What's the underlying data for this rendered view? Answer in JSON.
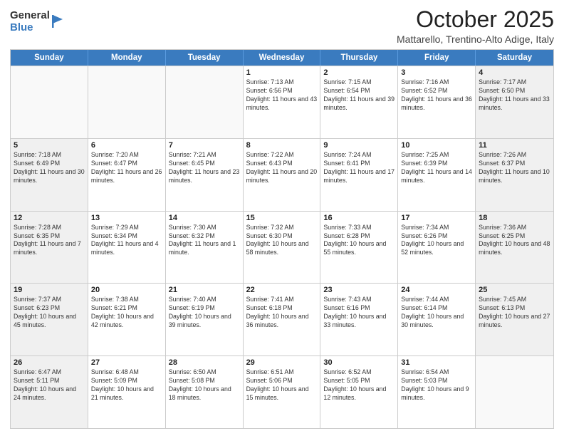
{
  "header": {
    "logo_general": "General",
    "logo_blue": "Blue",
    "title": "October 2025",
    "location": "Mattarello, Trentino-Alto Adige, Italy"
  },
  "days_of_week": [
    "Sunday",
    "Monday",
    "Tuesday",
    "Wednesday",
    "Thursday",
    "Friday",
    "Saturday"
  ],
  "weeks": [
    [
      {
        "day": "",
        "content": ""
      },
      {
        "day": "",
        "content": ""
      },
      {
        "day": "",
        "content": ""
      },
      {
        "day": "1",
        "content": "Sunrise: 7:13 AM\nSunset: 6:56 PM\nDaylight: 11 hours and 43 minutes."
      },
      {
        "day": "2",
        "content": "Sunrise: 7:15 AM\nSunset: 6:54 PM\nDaylight: 11 hours and 39 minutes."
      },
      {
        "day": "3",
        "content": "Sunrise: 7:16 AM\nSunset: 6:52 PM\nDaylight: 11 hours and 36 minutes."
      },
      {
        "day": "4",
        "content": "Sunrise: 7:17 AM\nSunset: 6:50 PM\nDaylight: 11 hours and 33 minutes."
      }
    ],
    [
      {
        "day": "5",
        "content": "Sunrise: 7:18 AM\nSunset: 6:49 PM\nDaylight: 11 hours and 30 minutes."
      },
      {
        "day": "6",
        "content": "Sunrise: 7:20 AM\nSunset: 6:47 PM\nDaylight: 11 hours and 26 minutes."
      },
      {
        "day": "7",
        "content": "Sunrise: 7:21 AM\nSunset: 6:45 PM\nDaylight: 11 hours and 23 minutes."
      },
      {
        "day": "8",
        "content": "Sunrise: 7:22 AM\nSunset: 6:43 PM\nDaylight: 11 hours and 20 minutes."
      },
      {
        "day": "9",
        "content": "Sunrise: 7:24 AM\nSunset: 6:41 PM\nDaylight: 11 hours and 17 minutes."
      },
      {
        "day": "10",
        "content": "Sunrise: 7:25 AM\nSunset: 6:39 PM\nDaylight: 11 hours and 14 minutes."
      },
      {
        "day": "11",
        "content": "Sunrise: 7:26 AM\nSunset: 6:37 PM\nDaylight: 11 hours and 10 minutes."
      }
    ],
    [
      {
        "day": "12",
        "content": "Sunrise: 7:28 AM\nSunset: 6:35 PM\nDaylight: 11 hours and 7 minutes."
      },
      {
        "day": "13",
        "content": "Sunrise: 7:29 AM\nSunset: 6:34 PM\nDaylight: 11 hours and 4 minutes."
      },
      {
        "day": "14",
        "content": "Sunrise: 7:30 AM\nSunset: 6:32 PM\nDaylight: 11 hours and 1 minute."
      },
      {
        "day": "15",
        "content": "Sunrise: 7:32 AM\nSunset: 6:30 PM\nDaylight: 10 hours and 58 minutes."
      },
      {
        "day": "16",
        "content": "Sunrise: 7:33 AM\nSunset: 6:28 PM\nDaylight: 10 hours and 55 minutes."
      },
      {
        "day": "17",
        "content": "Sunrise: 7:34 AM\nSunset: 6:26 PM\nDaylight: 10 hours and 52 minutes."
      },
      {
        "day": "18",
        "content": "Sunrise: 7:36 AM\nSunset: 6:25 PM\nDaylight: 10 hours and 48 minutes."
      }
    ],
    [
      {
        "day": "19",
        "content": "Sunrise: 7:37 AM\nSunset: 6:23 PM\nDaylight: 10 hours and 45 minutes."
      },
      {
        "day": "20",
        "content": "Sunrise: 7:38 AM\nSunset: 6:21 PM\nDaylight: 10 hours and 42 minutes."
      },
      {
        "day": "21",
        "content": "Sunrise: 7:40 AM\nSunset: 6:19 PM\nDaylight: 10 hours and 39 minutes."
      },
      {
        "day": "22",
        "content": "Sunrise: 7:41 AM\nSunset: 6:18 PM\nDaylight: 10 hours and 36 minutes."
      },
      {
        "day": "23",
        "content": "Sunrise: 7:43 AM\nSunset: 6:16 PM\nDaylight: 10 hours and 33 minutes."
      },
      {
        "day": "24",
        "content": "Sunrise: 7:44 AM\nSunset: 6:14 PM\nDaylight: 10 hours and 30 minutes."
      },
      {
        "day": "25",
        "content": "Sunrise: 7:45 AM\nSunset: 6:13 PM\nDaylight: 10 hours and 27 minutes."
      }
    ],
    [
      {
        "day": "26",
        "content": "Sunrise: 6:47 AM\nSunset: 5:11 PM\nDaylight: 10 hours and 24 minutes."
      },
      {
        "day": "27",
        "content": "Sunrise: 6:48 AM\nSunset: 5:09 PM\nDaylight: 10 hours and 21 minutes."
      },
      {
        "day": "28",
        "content": "Sunrise: 6:50 AM\nSunset: 5:08 PM\nDaylight: 10 hours and 18 minutes."
      },
      {
        "day": "29",
        "content": "Sunrise: 6:51 AM\nSunset: 5:06 PM\nDaylight: 10 hours and 15 minutes."
      },
      {
        "day": "30",
        "content": "Sunrise: 6:52 AM\nSunset: 5:05 PM\nDaylight: 10 hours and 12 minutes."
      },
      {
        "day": "31",
        "content": "Sunrise: 6:54 AM\nSunset: 5:03 PM\nDaylight: 10 hours and 9 minutes."
      },
      {
        "day": "",
        "content": ""
      }
    ]
  ]
}
